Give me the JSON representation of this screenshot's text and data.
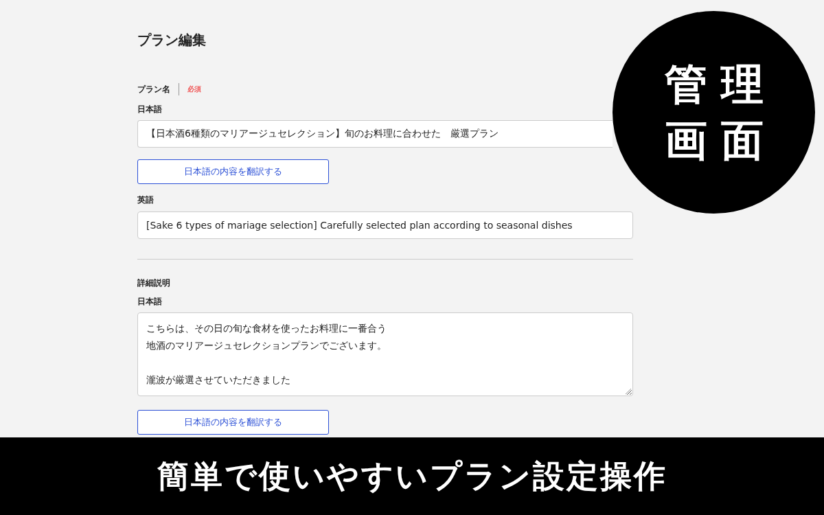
{
  "page_title": "プラン編集",
  "plan_name": {
    "label": "プラン名",
    "required_badge": "必須",
    "japanese": {
      "label": "日本語",
      "value": "【日本酒6種類のマリアージュセレクション】旬のお料理に合わせた　厳選プラン"
    },
    "translate_button": "日本語の内容を翻訳する",
    "english": {
      "label": "英語",
      "value": "[Sake 6 types of mariage selection] Carefully selected plan according to seasonal dishes"
    }
  },
  "description": {
    "label": "詳細説明",
    "japanese": {
      "label": "日本語",
      "paragraphs": [
        [
          "こちらは、その日の旬な食材を使ったお料理に一番合う",
          "地酒のマリアージュセレクションプランでございます。"
        ],
        [
          "瀧波が厳選させていただきました"
        ]
      ]
    },
    "translate_button": "日本語の内容を翻訳する"
  },
  "circle_badge": [
    "管理",
    "画面"
  ],
  "bottom_banner": "簡単で使いやすいプラン設定操作"
}
